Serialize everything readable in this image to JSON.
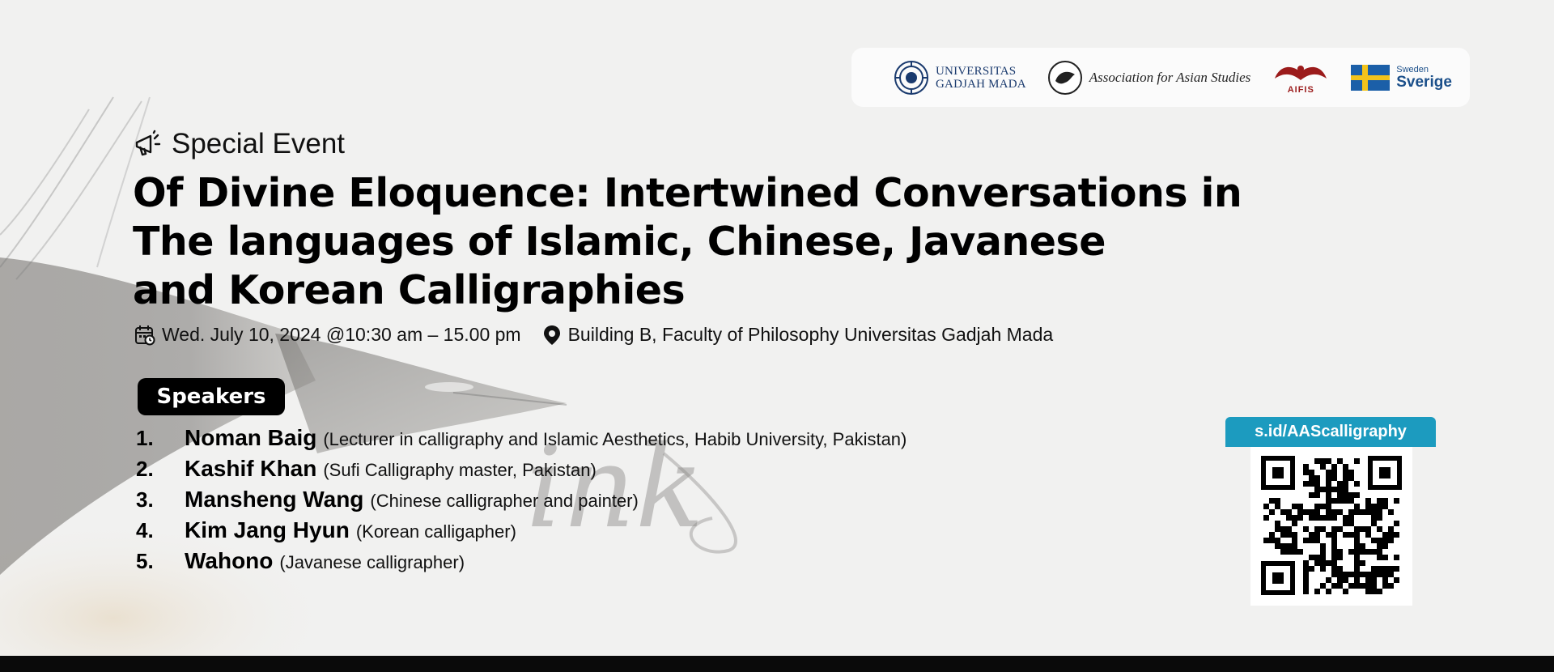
{
  "logos": {
    "ugm_line1": "UNIVERSITAS",
    "ugm_line2": "GADJAH MADA",
    "aas": "Association for Asian Studies",
    "aifis": "AIFIS",
    "sweden_small": "Sweden",
    "sweden_big": "Sverige"
  },
  "event": {
    "kicker": "Special Event",
    "title_lines": [
      "Of Divine Eloquence: Intertwined Conversations in",
      "The languages of Islamic, Chinese, Javanese",
      "and Korean Calligraphies"
    ],
    "datetime": "Wed. July 10, 2024 @10:30 am – 15.00 pm",
    "location": "Building B, Faculty of Philosophy Universitas Gadjah Mada"
  },
  "speakers": {
    "heading": "Speakers",
    "items": [
      {
        "num": "1.",
        "name": "Noman Baig",
        "desc": "(Lecturer in calligraphy and Islamic Aesthetics, Habib University, Pakistan)"
      },
      {
        "num": "2.",
        "name": "Kashif Khan",
        "desc": "(Sufi Calligraphy master, Pakistan)"
      },
      {
        "num": "3.",
        "name": "Mansheng Wang",
        "desc": "(Chinese calligrapher and painter)"
      },
      {
        "num": "4.",
        "name": "Kim Jang Hyun",
        "desc": "(Korean calligapher)"
      },
      {
        "num": "5.",
        "name": "Wahono",
        "desc": "(Javanese calligrapher)"
      }
    ]
  },
  "qr": {
    "link": "s.id/AAScalligraphy"
  },
  "background_text": "ink",
  "colors": {
    "background": "#f1f1f0",
    "qr_tag": "#1c9bbf",
    "footer": "#0a0a0a",
    "ugm_blue": "#1a3a6e",
    "aifis_red": "#9b1b1b",
    "sweden_blue": "#1b4f8a",
    "sweden_yellow": "#f3c31b"
  }
}
